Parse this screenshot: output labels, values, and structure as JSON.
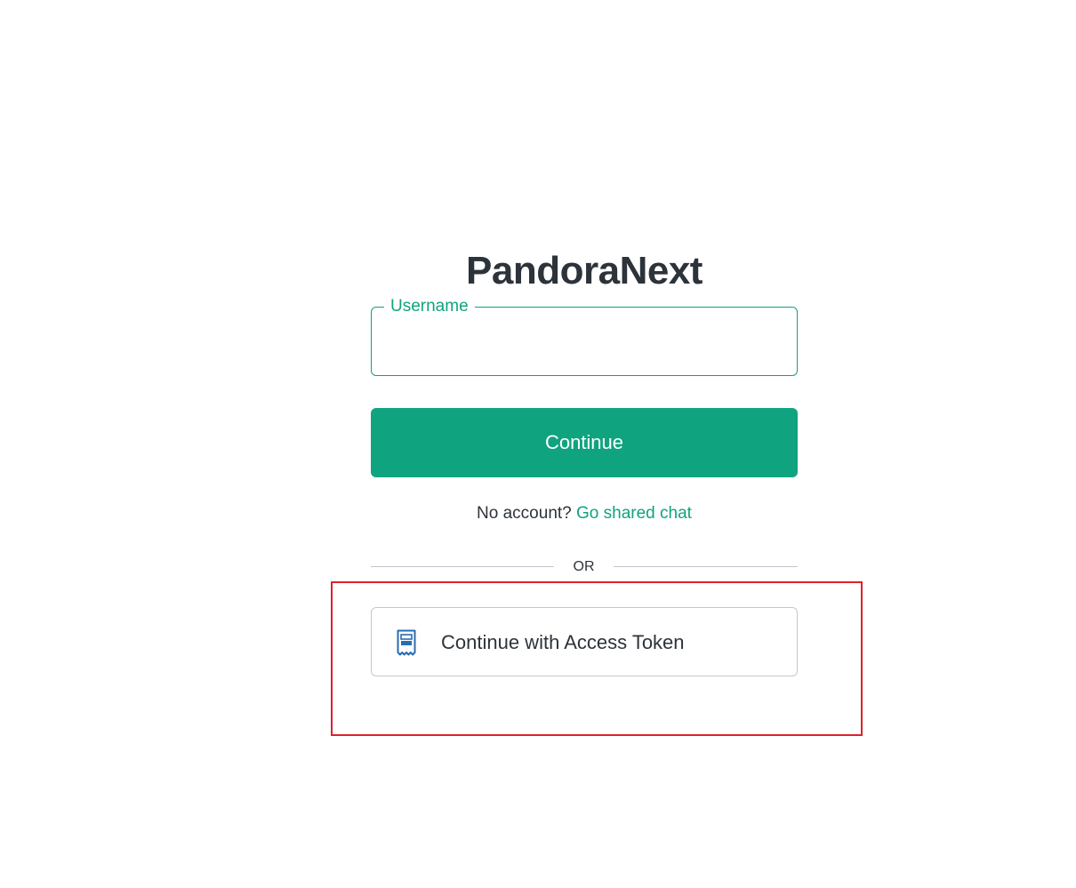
{
  "app": {
    "title": "PandoraNext"
  },
  "login": {
    "username_label": "Username",
    "username_value": "",
    "continue_label": "Continue",
    "no_account_text": "No account?",
    "shared_chat_link": "Go shared chat",
    "divider_text": "OR",
    "access_token_label": "Continue with Access Token",
    "access_token_icon": "receipt-icon"
  },
  "colors": {
    "accent": "#10a37f",
    "text": "#2d333a",
    "border": "#c2c8d0",
    "highlight": "#e0202b",
    "icon": "#2b6cb0"
  }
}
